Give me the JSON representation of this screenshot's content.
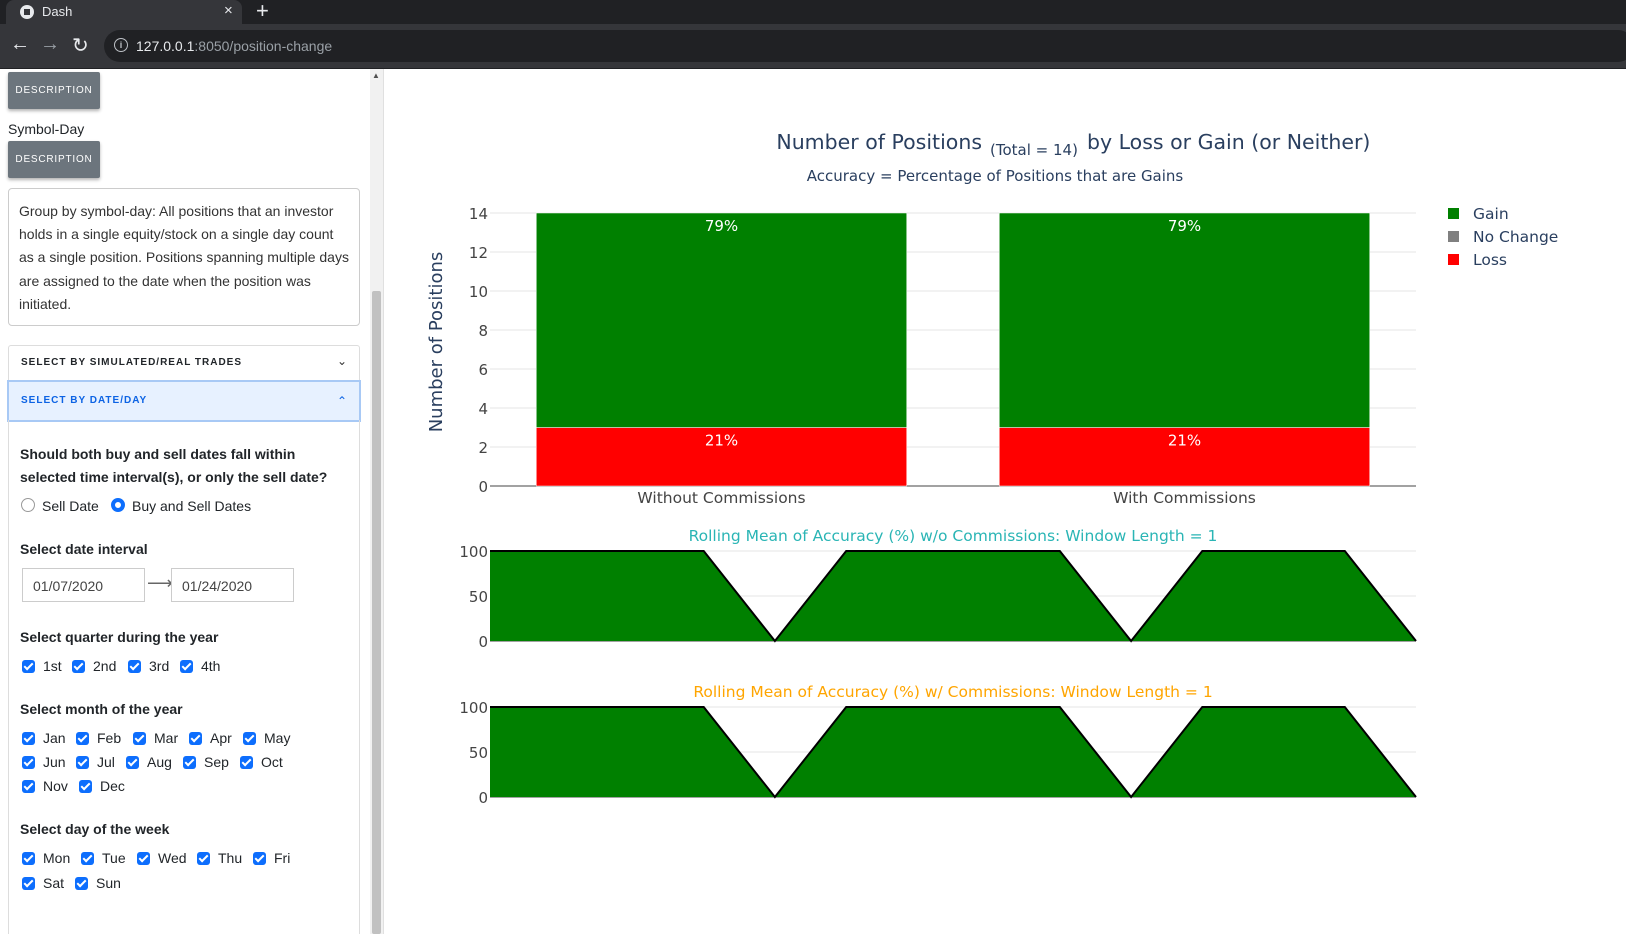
{
  "browser": {
    "tab_title": "Dash",
    "tab_close": "×",
    "new_tab": "+",
    "url_host": "127.0.0.1",
    "url_path": ":8050/position-change"
  },
  "sidebar": {
    "description_button": "DESCRIPTION",
    "symbol_day_label": "Symbol-Day",
    "description_text": "Group by symbol-day: All positions that an investor holds in a single equity/stock on a single day count as a single position. Positions spanning multiple days are assigned to the date when the position was initiated.",
    "accordion_sim_real": "SELECT BY SIMULATED/REAL TRADES",
    "accordion_date_day": "SELECT BY DATE/DAY",
    "date_fall_question": "Should both buy and sell dates fall within selected time interval(s), or only the sell date?",
    "radio_options": [
      {
        "label": "Sell Date",
        "selected": false
      },
      {
        "label": "Buy and Sell Dates",
        "selected": true
      }
    ],
    "date_interval_label": "Select date interval",
    "start_date": "01/07/2020",
    "end_date": "01/24/2020",
    "quarter_label": "Select quarter during the year",
    "quarters": [
      "1st",
      "2nd",
      "3rd",
      "4th"
    ],
    "month_label": "Select month of the year",
    "months": [
      "Jan",
      "Feb",
      "Mar",
      "Apr",
      "May",
      "Jun",
      "Jul",
      "Aug",
      "Sep",
      "Oct",
      "Nov",
      "Dec"
    ],
    "weekday_label": "Select day of the week",
    "weekdays": [
      "Mon",
      "Tue",
      "Wed",
      "Thu",
      "Fri",
      "Sat",
      "Sun"
    ]
  },
  "colors": {
    "gain": "#008000",
    "no_change": "#808080",
    "loss": "#ff0000",
    "title": "#2a3f5f",
    "rolling_wo": "#2ab5b5",
    "rolling_w": "#ffa500",
    "accent": "#0d6efd"
  },
  "chart_data": [
    {
      "type": "bar",
      "title": "Number of Positions",
      "title_sub": "(Total = 14)",
      "title_suffix": "by Loss or Gain (or Neither)",
      "subtitle": "Accuracy = Percentage of Positions that are Gains",
      "ylabel": "Number of Positions",
      "categories": [
        "Without Commissions",
        "With Commissions"
      ],
      "ylim": [
        0,
        14
      ],
      "yticks": [
        0,
        2,
        4,
        6,
        8,
        10,
        12,
        14
      ],
      "stacked": true,
      "series": [
        {
          "name": "Gain",
          "values": [
            11,
            11
          ],
          "labels": [
            "79%",
            "79%"
          ]
        },
        {
          "name": "No Change",
          "values": [
            0,
            0
          ],
          "labels": [
            "",
            ""
          ]
        },
        {
          "name": "Loss",
          "values": [
            3,
            3
          ],
          "labels": [
            "21%",
            "21%"
          ]
        }
      ],
      "legend": "top-right",
      "grid": true
    },
    {
      "type": "area",
      "title": "Rolling Mean of Accuracy (%) w/o Commissions:  Window Length = 1",
      "values": [
        100,
        100,
        100,
        100,
        0,
        100,
        100,
        100,
        100,
        0,
        100,
        100,
        100,
        0
      ],
      "ylim": [
        0,
        100
      ],
      "yticks": [
        0,
        50,
        100
      ],
      "grid": true
    },
    {
      "type": "area",
      "title": "Rolling Mean of Accuracy (%) w/ Commissions:  Window Length = 1",
      "values": [
        100,
        100,
        100,
        100,
        0,
        100,
        100,
        100,
        100,
        0,
        100,
        100,
        100,
        0
      ],
      "ylim": [
        0,
        100
      ],
      "yticks": [
        0,
        50,
        100
      ],
      "grid": true
    }
  ]
}
